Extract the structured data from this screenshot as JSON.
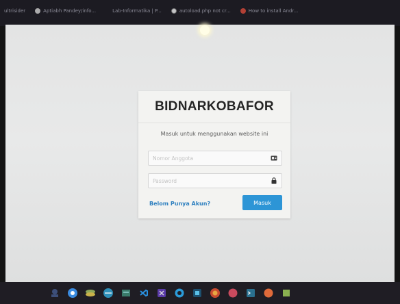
{
  "browser": {
    "bookmarks": [
      {
        "label": "ultrisider",
        "icon": "page-icon"
      },
      {
        "label": "Aptiabh Pandey/info...",
        "icon": "page-icon"
      },
      {
        "label": "Lab-Informatika | P...",
        "icon": "page-icon"
      },
      {
        "label": "autoload.php not cr...",
        "icon": "google-icon"
      },
      {
        "label": "How to install Andr...",
        "icon": "stackoverflow-icon"
      }
    ]
  },
  "login": {
    "brand": "BIDNARKOBAFOR",
    "subtitle": "Masuk untuk menggunakan website ini",
    "member_placeholder": "Nomor Anggota",
    "password_placeholder": "Password",
    "signup_link": "Belom Punya Akun?",
    "submit_label": "Masuk"
  },
  "colors": {
    "accent": "#2d95d6",
    "link": "#2d7fbf",
    "card_bg": "#f3f3f1",
    "page_bg": "#e3e4e4"
  },
  "taskbar": {
    "apps": [
      "explorer-icon",
      "chrome-icon",
      "stack-icon",
      "network-icon",
      "files-icon",
      "vscode-icon",
      "vs-icon",
      "ie-icon",
      "photoshop-icon",
      "firefox-icon",
      "app-icon",
      "terminal-icon",
      "app2-icon",
      "app3-icon"
    ]
  }
}
